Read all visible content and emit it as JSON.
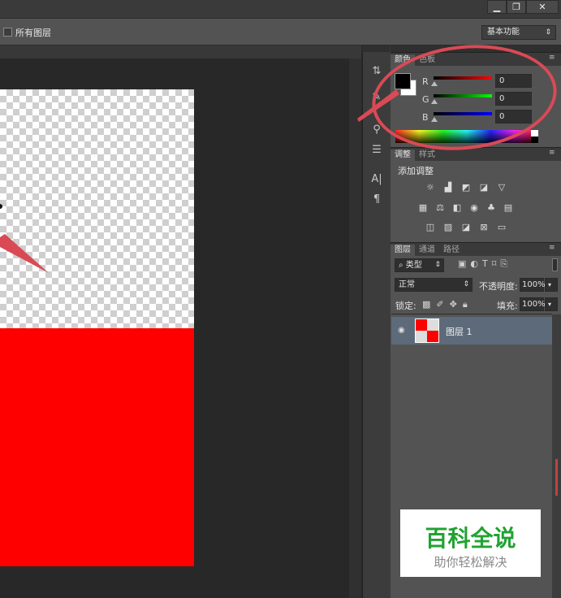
{
  "window": {
    "minimize_label": "▁",
    "restore_label": "❐",
    "close_label": "✕"
  },
  "options_bar": {
    "all_layers_label": "所有图层",
    "workspace_value": "基本功能"
  },
  "color_panel": {
    "tabs": [
      "颜色",
      "色板"
    ],
    "channels": [
      {
        "label": "R",
        "value": "0",
        "color": "#e00000"
      },
      {
        "label": "G",
        "value": "0",
        "color": "#00c000"
      },
      {
        "label": "B",
        "value": "0",
        "color": "#0000e0"
      }
    ],
    "foreground": "#000000",
    "background": "#ffffff"
  },
  "adjust_panel": {
    "tabs": [
      "调整",
      "样式"
    ],
    "title": "添加调整"
  },
  "layers_panel": {
    "tabs": [
      "图层",
      "通道",
      "路径"
    ],
    "filter_label": "类型",
    "blend_mode": "正常",
    "opacity_label": "不透明度:",
    "opacity_value": "100%",
    "lock_label": "锁定:",
    "fill_label": "填充:",
    "fill_value": "100%",
    "layers": [
      {
        "name": "图层 1",
        "visible": true
      }
    ]
  },
  "watermark": {
    "title": "百科全说",
    "subtitle": "助你轻松解决"
  },
  "icons": [
    "move-icon",
    "brush-icon",
    "properties-icon",
    "character-icon",
    "paragraph-icon"
  ]
}
